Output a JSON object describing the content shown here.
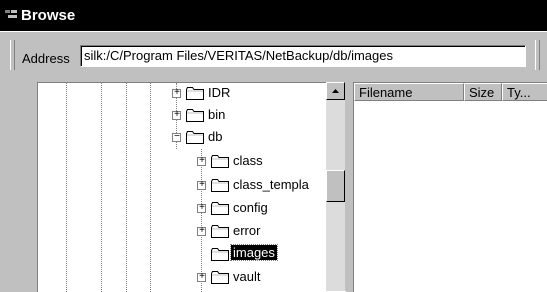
{
  "window": {
    "title": "Browse"
  },
  "address": {
    "label": "Address",
    "value": "silk:/C/Program Files/VERITAS/NetBackup/db/images"
  },
  "tree": {
    "items": [
      {
        "label": "IDR",
        "expander": "+"
      },
      {
        "label": "bin",
        "expander": "+"
      },
      {
        "label": "db",
        "expander": "−"
      },
      {
        "label": "class",
        "expander": "+"
      },
      {
        "label": "class_templa",
        "expander": "+"
      },
      {
        "label": "config",
        "expander": "+"
      },
      {
        "label": "error",
        "expander": "+"
      },
      {
        "label": "images",
        "expander": ""
      },
      {
        "label": "vault",
        "expander": "+"
      }
    ],
    "selected": "images"
  },
  "list": {
    "columns": [
      "Filename",
      "Size",
      "Ty..."
    ]
  },
  "colors": {
    "titlebar": "#000000",
    "folder": "#ffff00",
    "selection": "#000000"
  },
  "icons": [
    "window-icon",
    "folder-icon",
    "expand-icon",
    "collapse-icon",
    "scroll-up-icon"
  ]
}
